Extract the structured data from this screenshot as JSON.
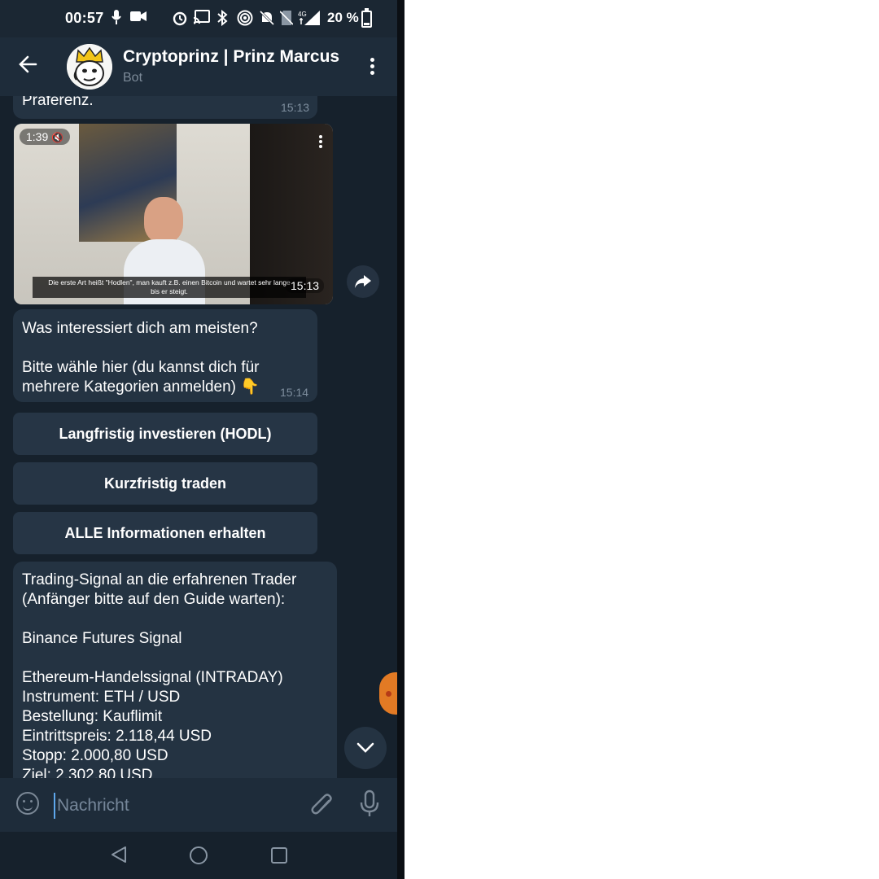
{
  "status_bar": {
    "time": "00:57",
    "battery_percent": "20 %",
    "icons": [
      "mic-icon",
      "video-icon",
      "alarm-icon",
      "cast-icon",
      "bluetooth-icon",
      "hotspot-icon",
      "mute-icon",
      "no-sim-icon",
      "4g-signal-icon",
      "battery-icon"
    ]
  },
  "header": {
    "title": "Cryptoprinz | Prinz Marcus",
    "subtitle": "Bot"
  },
  "messages": {
    "top": {
      "text": "Präferenz.",
      "time": "15:13"
    },
    "video": {
      "duration": "1:39",
      "subtitle_line1": "Die erste Art heißt \"Hodlen\", man kauft z.B. einen Bitcoin und wartet sehr lange",
      "subtitle_line2": "bis er steigt.",
      "time": "15:13"
    },
    "question": {
      "text": "Was interessiert dich am meisten?\n\nBitte wähle hier (du kannst dich für\nmehrere Kategorien anmelden) 👇",
      "time": "15:14"
    },
    "keyboard": [
      "Langfristig investieren (HODL)",
      "Kurzfristig traden",
      "ALLE Informationen erhalten"
    ],
    "signal": {
      "text": "Trading-Signal an die erfahrenen Trader\n(Anfänger bitte auf den Guide warten):\n\nBinance Futures Signal\n\nEthereum-Handelssignal (INTRADAY)\nInstrument: ETH / USD\nBestellung: Kauflimit\nEintrittspreis: 2.118,44 USD\nStopp: 2.000,80 USD\nZiel: 2.302,80 USD"
    }
  },
  "input": {
    "placeholder": "Nachricht"
  },
  "colors": {
    "chat_bg": "#16212c",
    "header_bg": "#1e2c3a",
    "bubble_bg": "#243342",
    "accent": "#5ea8ed"
  }
}
